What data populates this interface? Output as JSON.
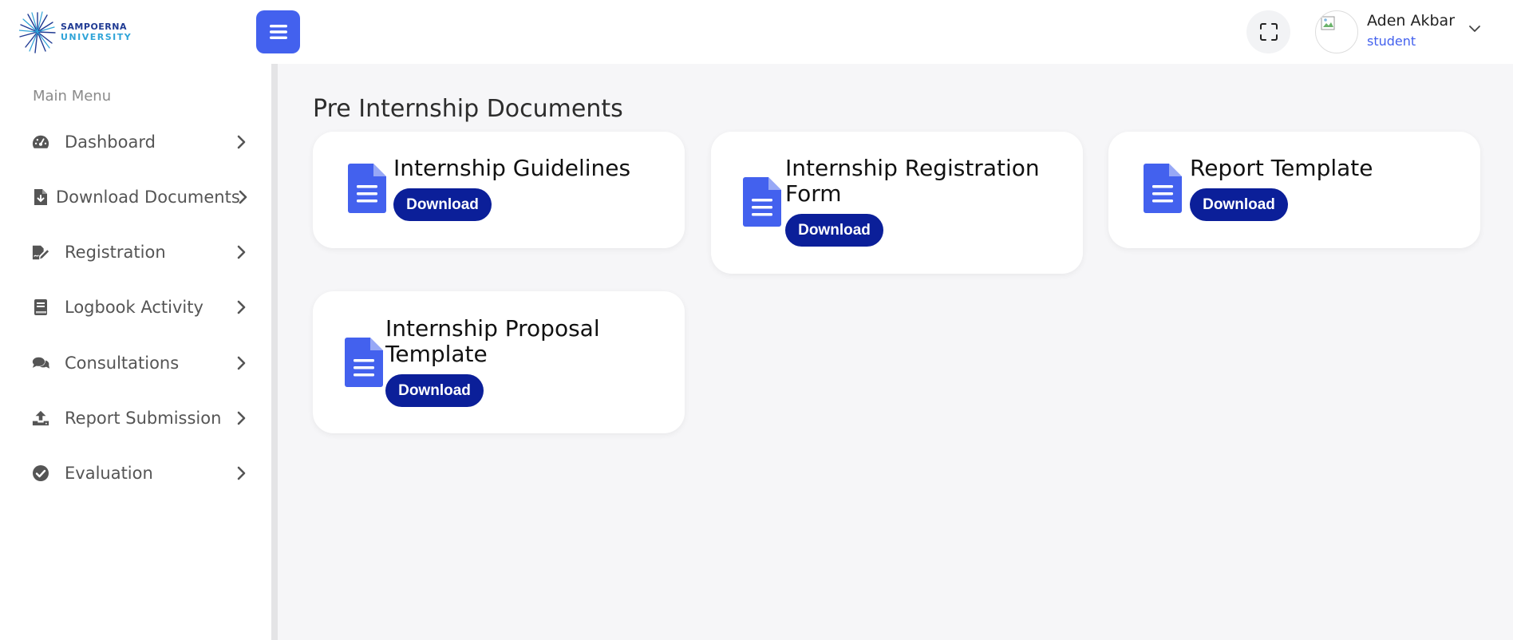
{
  "header": {
    "logo_line1": "SAMPOERNA",
    "logo_line2": "UNIVERSITY",
    "menu_icon": "hamburger-icon",
    "fullscreen_icon": "fullscreen-icon",
    "user": {
      "name": "Aden Akbar",
      "role": "student"
    },
    "caret_icon": "chevron-down-icon"
  },
  "sidebar": {
    "section_label": "Main Menu",
    "items": [
      {
        "label": "Dashboard",
        "icon": "speedometer-icon"
      },
      {
        "label": "Download Documents",
        "icon": "file-download-icon"
      },
      {
        "label": "Registration",
        "icon": "signature-icon"
      },
      {
        "label": "Logbook Activity",
        "icon": "book-icon"
      },
      {
        "label": "Consultations",
        "icon": "comments-icon"
      },
      {
        "label": "Report Submission",
        "icon": "upload-icon"
      },
      {
        "label": "Evaluation",
        "icon": "check-circle-icon"
      }
    ]
  },
  "main": {
    "title": "Pre Internship Documents",
    "documents": [
      {
        "title": "Internship Guidelines",
        "button": "Download"
      },
      {
        "title": "Internship Registration Form",
        "button": "Download"
      },
      {
        "title": "Report Template",
        "button": "Download"
      },
      {
        "title": "Internship Proposal Template",
        "button": "Download"
      }
    ]
  },
  "colors": {
    "accent": "#4361ee",
    "button": "#0b1f99",
    "background": "#f6f6f8"
  }
}
